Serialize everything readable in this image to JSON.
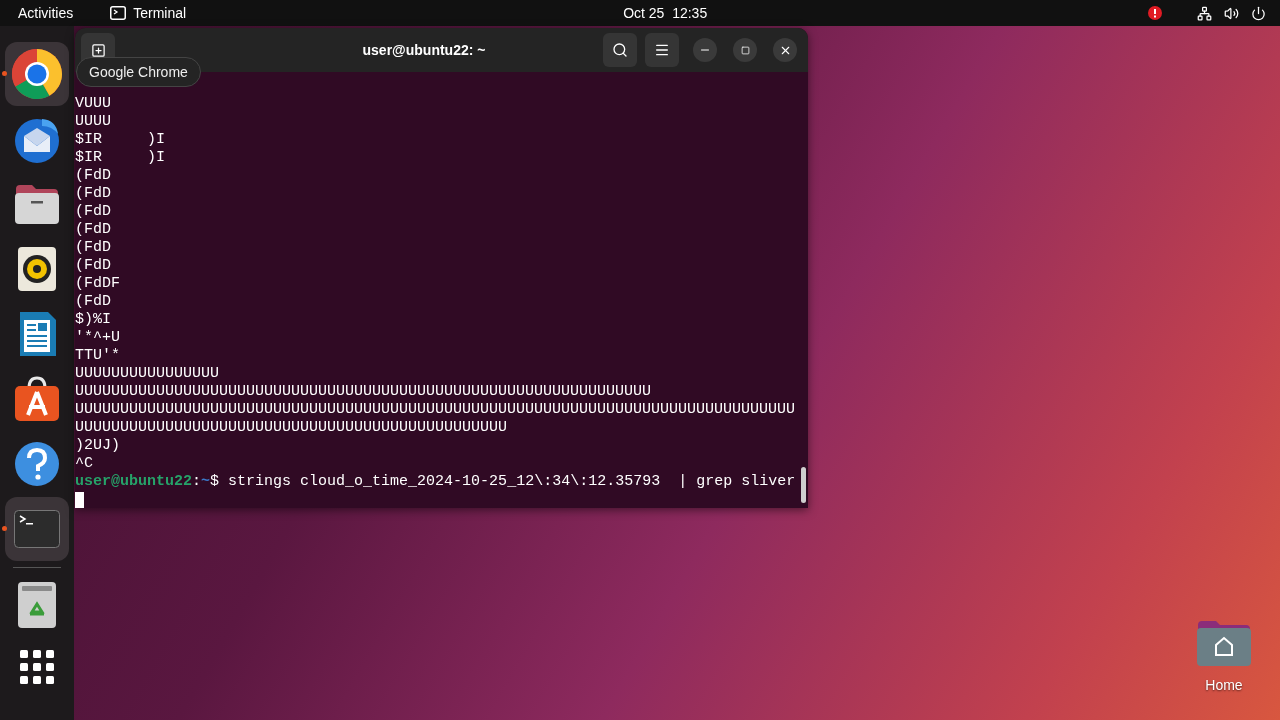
{
  "top_bar": {
    "activities": "Activities",
    "app_name": "Terminal",
    "clock": "Oct 25  12:35"
  },
  "dock": {
    "items": [
      {
        "kind": "chrome",
        "running": true,
        "highlighted": true
      },
      {
        "kind": "mail",
        "running": false,
        "highlighted": false
      },
      {
        "kind": "files",
        "running": false,
        "highlighted": false
      },
      {
        "kind": "speaker",
        "running": false,
        "highlighted": false
      },
      {
        "kind": "writer",
        "running": false,
        "highlighted": false
      },
      {
        "kind": "store",
        "running": false,
        "highlighted": false
      },
      {
        "kind": "help",
        "running": false,
        "highlighted": false
      },
      {
        "kind": "terminal",
        "running": true,
        "highlighted": true
      },
      {
        "kind": "trash",
        "running": false,
        "highlighted": false
      },
      {
        "kind": "apps",
        "running": false,
        "highlighted": false
      }
    ]
  },
  "tooltip": "Google Chrome",
  "window": {
    "title": "user@ubuntu22: ~"
  },
  "terminal": {
    "lines": [
      "VUUU",
      "UUUU",
      "$IR     )I",
      "$IR     )I",
      "(FdD",
      "(FdD",
      "(FdD",
      "(FdD",
      "(FdD",
      "(FdD",
      "(FdDF",
      "(FdD",
      "$)%I",
      "'*^+U",
      "TTU'*",
      "UUUUUUUUUUUUUUUU",
      "UUUUUUUUUUUUUUUUUUUUUUUUUUUUUUUUUUUUUUUUUUUUUUUUUUUUUUUUUUUUUUUU",
      "UUUUUUUUUUUUUUUUUUUUUUUUUUUUUUUUUUUUUUUUUUUUUUUUUUUUUUUUUUUUUUUUUUUUUUUUUUUUUUUU",
      "UUUUUUUUUUUUUUUUUUUUUUUUUUUUUUUUUUUUUUUUUUUUUUUU",
      ")2UJ)",
      "^C"
    ],
    "prompt": {
      "user_host": "user@ubuntu22",
      "separator": ":",
      "path": "~",
      "symbol": "$",
      "command": " strings cloud_o_time_2024-10-25_12\\:34\\:12.35793  | grep sliver"
    }
  },
  "desktop": {
    "icons": [
      {
        "label": "Home"
      }
    ]
  }
}
